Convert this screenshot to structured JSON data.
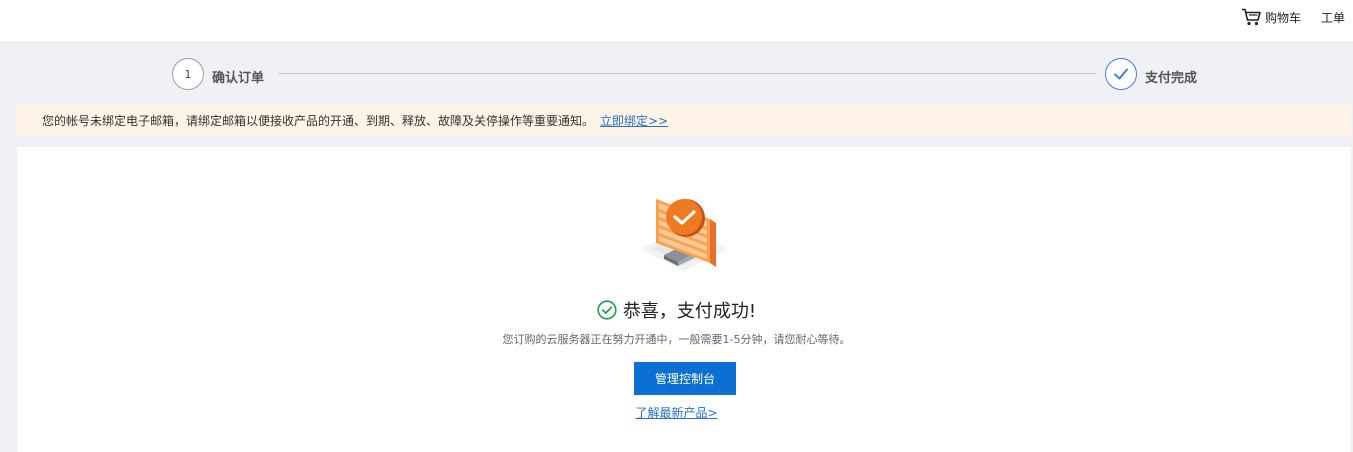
{
  "header": {
    "cart_icon": "shopping-cart-icon",
    "cart_label": "购物车",
    "workorder_label": "工单"
  },
  "steps": {
    "items": [
      {
        "number": "1",
        "label": "确认订单",
        "state": "done"
      },
      {
        "icon": "check-icon",
        "label": "支付完成",
        "state": "active"
      }
    ],
    "active_color": "#4a7bd9"
  },
  "notice": {
    "text": "您的帐号未绑定电子邮箱，请绑定邮箱以便接收产品的开通、到期、释放、故障及关停操作等重要通知。",
    "link_label": "立即绑定>>"
  },
  "result": {
    "illustration": "monitor-checkmark-illustration",
    "status_icon": "check-circle-icon",
    "title": "恭喜，支付成功!",
    "description": "您订购的云服务器正在努力开通中，一般需要1-5分钟，请您耐心等待。",
    "console_button_label": "管理控制台",
    "more_link_label": "了解最新产品>"
  },
  "colors": {
    "primary": "#0b6fd3",
    "link": "#2a6fc9",
    "success": "#1f9b4d",
    "notice_bg": "#fef3e6",
    "illustration_orange": "#f07a24"
  }
}
